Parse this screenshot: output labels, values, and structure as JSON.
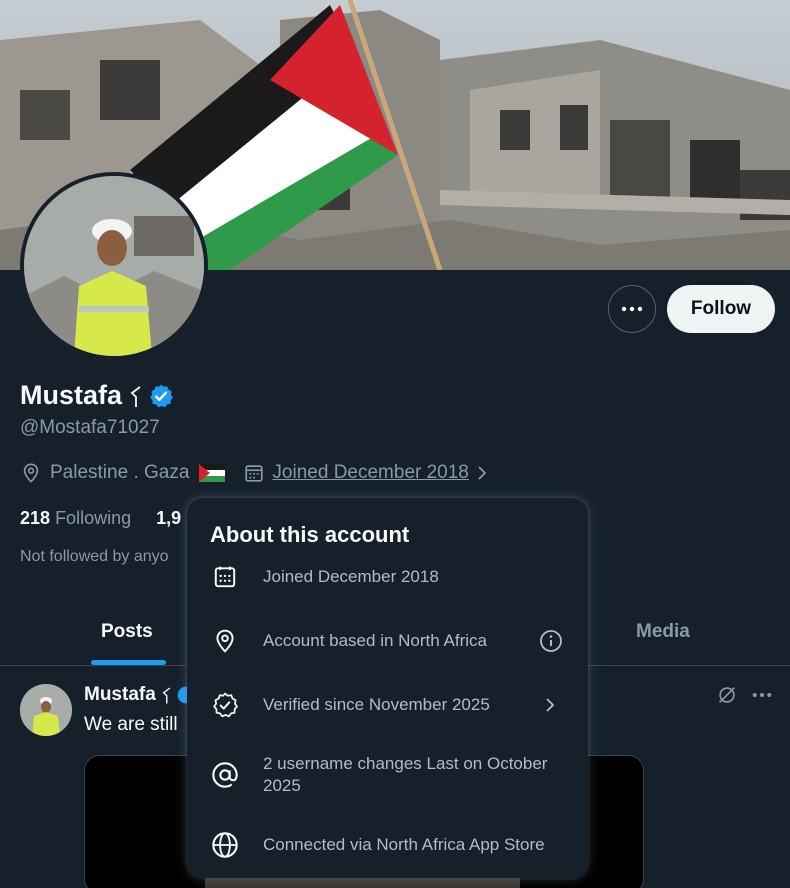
{
  "profile": {
    "name": "Mustafa",
    "handle": "@Mostafa71027",
    "location": "Palestine . Gaza",
    "joined": "Joined December 2018",
    "following_count": "218",
    "following_label": "Following",
    "followers_count_partial": "1,9",
    "not_followed": "Not followed by anyo"
  },
  "actions": {
    "follow_label": "Follow"
  },
  "tabs": [
    {
      "label": "Posts",
      "active": true
    },
    {
      "label": "Media",
      "active": false
    }
  ],
  "post": {
    "author": "Mustafa",
    "text_partial": "We are still"
  },
  "about_popup": {
    "title": "About this account",
    "rows": [
      {
        "icon": "calendar-icon",
        "text": "Joined December 2018"
      },
      {
        "icon": "location-pin-icon",
        "text": "Account based in North Africa"
      },
      {
        "icon": "verified-badge-icon",
        "text": "Verified since November 2025"
      },
      {
        "icon": "at-sign-icon",
        "text": "2 username changes Last on October 2025"
      },
      {
        "icon": "globe-icon",
        "text": "Connected via North Africa App Store"
      }
    ]
  },
  "colors": {
    "background": "#15202b",
    "accent": "#1d9bf0",
    "muted_text": "#8b98a5",
    "verified_blue": "#1d9bf0"
  }
}
